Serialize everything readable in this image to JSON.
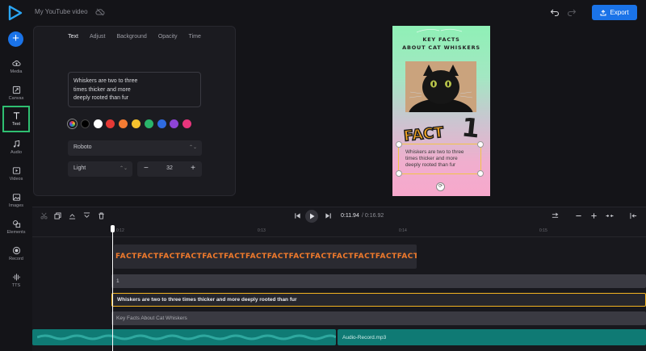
{
  "header": {
    "project_title": "My YouTube video",
    "export_label": "Export"
  },
  "sidebar": {
    "add_label": "+",
    "items": [
      {
        "label": "Media"
      },
      {
        "label": "Canvas"
      },
      {
        "label": "Text"
      },
      {
        "label": "Audio"
      },
      {
        "label": "Videos"
      },
      {
        "label": "Images"
      },
      {
        "label": "Elements"
      },
      {
        "label": "Record"
      },
      {
        "label": "TTS"
      }
    ],
    "active": "Text"
  },
  "panel": {
    "tabs": [
      "Text",
      "Adjust",
      "Background",
      "Opacity",
      "Time"
    ],
    "active_tab": "Text",
    "text_value": "Whiskers are two to three times thicker and more deeply rooted than fur",
    "text_lines": [
      "Whiskers are two to three",
      "times thicker and more",
      "deeply rooted than fur"
    ],
    "swatches": [
      "#000000",
      "#ffffff",
      "#e53935",
      "#f57c33",
      "#f5c22e",
      "#2ab56a",
      "#2f6be0",
      "#8e44d6",
      "#e7357c"
    ],
    "font": "Roboto",
    "weight": "Light",
    "size": "32",
    "minus": "−",
    "plus": "+"
  },
  "canvas": {
    "title_line1": "KEY FACTS",
    "title_line2": "ABOUT CAT WHISKERS",
    "fact_text": "FACT",
    "fact_number": "1",
    "body_lines": [
      "Whiskers are two to three",
      "times thicker and more",
      "deeply rooted than fur"
    ],
    "rotate": "⟳"
  },
  "timeline": {
    "current_time": "0:11.94",
    "total_time": "/ 0:16.92",
    "ticks": [
      "0:12",
      "0:13",
      "0:14",
      "0:15"
    ],
    "fact_clip_text": "FACTFACTFACTFACTFACTFACTFACTFACTFACTFACTFACTFACTFACTFACT",
    "number_clip": "1",
    "text_clip": "Whiskers are two to three times thicker and more deeply rooted than fur",
    "title_clip": "Key Facts About Cat Whiskers",
    "audio_clip": "Audio-Record.mp3"
  },
  "colors": {
    "accent": "#1a73e8",
    "active_nav": "#2fbf71",
    "selection": "#f2b321",
    "audio": "#0f7a74"
  }
}
